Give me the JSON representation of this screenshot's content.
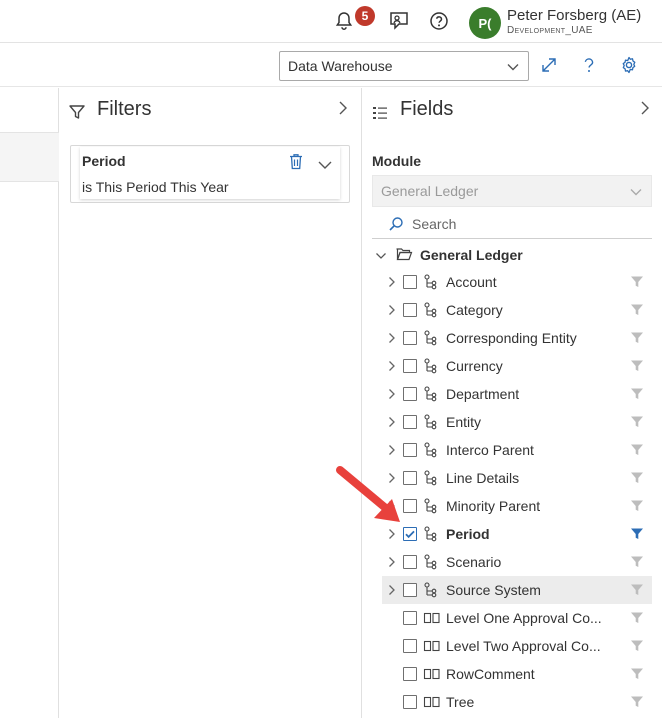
{
  "header": {
    "notifications_count": "5",
    "avatar_initials": "P(",
    "user_name": "Peter Forsberg (AE)",
    "user_subtitle": "Development_UAE"
  },
  "toolbar": {
    "datasource_selected": "Data Warehouse"
  },
  "filters_panel": {
    "title": "Filters",
    "filters": [
      {
        "field": "Period",
        "condition": "is This Period This Year"
      }
    ]
  },
  "fields_panel": {
    "title": "Fields",
    "module_label": "Module",
    "module_selected": "General Ledger",
    "search_placeholder": "Search",
    "root_folder": "General Ledger",
    "items": [
      {
        "label": "Account",
        "kind": "hierarchy",
        "checked": false,
        "filtered": false
      },
      {
        "label": "Category",
        "kind": "hierarchy",
        "checked": false,
        "filtered": false
      },
      {
        "label": "Corresponding Entity",
        "kind": "hierarchy",
        "checked": false,
        "filtered": false
      },
      {
        "label": "Currency",
        "kind": "hierarchy",
        "checked": false,
        "filtered": false
      },
      {
        "label": "Department",
        "kind": "hierarchy",
        "checked": false,
        "filtered": false
      },
      {
        "label": "Entity",
        "kind": "hierarchy",
        "checked": false,
        "filtered": false
      },
      {
        "label": "Interco Parent",
        "kind": "hierarchy",
        "checked": false,
        "filtered": false
      },
      {
        "label": "Line Details",
        "kind": "hierarchy",
        "checked": false,
        "filtered": false
      },
      {
        "label": "Minority Parent",
        "kind": "hierarchy",
        "checked": false,
        "filtered": false
      },
      {
        "label": "Period",
        "kind": "hierarchy",
        "checked": true,
        "filtered": true
      },
      {
        "label": "Scenario",
        "kind": "hierarchy",
        "checked": false,
        "filtered": false
      },
      {
        "label": "Source System",
        "kind": "hierarchy",
        "checked": false,
        "filtered": false
      },
      {
        "label": "Level One Approval Co...",
        "kind": "attribute",
        "checked": false,
        "filtered": false
      },
      {
        "label": "Level Two Approval Co...",
        "kind": "attribute",
        "checked": false,
        "filtered": false
      },
      {
        "label": "RowComment",
        "kind": "attribute",
        "checked": false,
        "filtered": false
      },
      {
        "label": "Tree",
        "kind": "attribute",
        "checked": false,
        "filtered": false
      }
    ]
  },
  "colors": {
    "accent_blue": "#2c6db5",
    "badge_red": "#c0392b",
    "avatar_green": "#3a7d2c",
    "annotation_arrow": "#e8413c",
    "filter_inactive": "#bdbdbd"
  },
  "icons": {
    "notifications": "bell-icon",
    "feedback": "chat-user-icon",
    "help": "help-circle-icon",
    "expand": "expand-diagonal-icon",
    "settings": "gear-icon",
    "filter": "funnel-icon",
    "fields": "list-icon",
    "hierarchy": "hierarchy-icon",
    "attribute": "attribute-columns-icon",
    "folder": "folder-open-icon"
  }
}
